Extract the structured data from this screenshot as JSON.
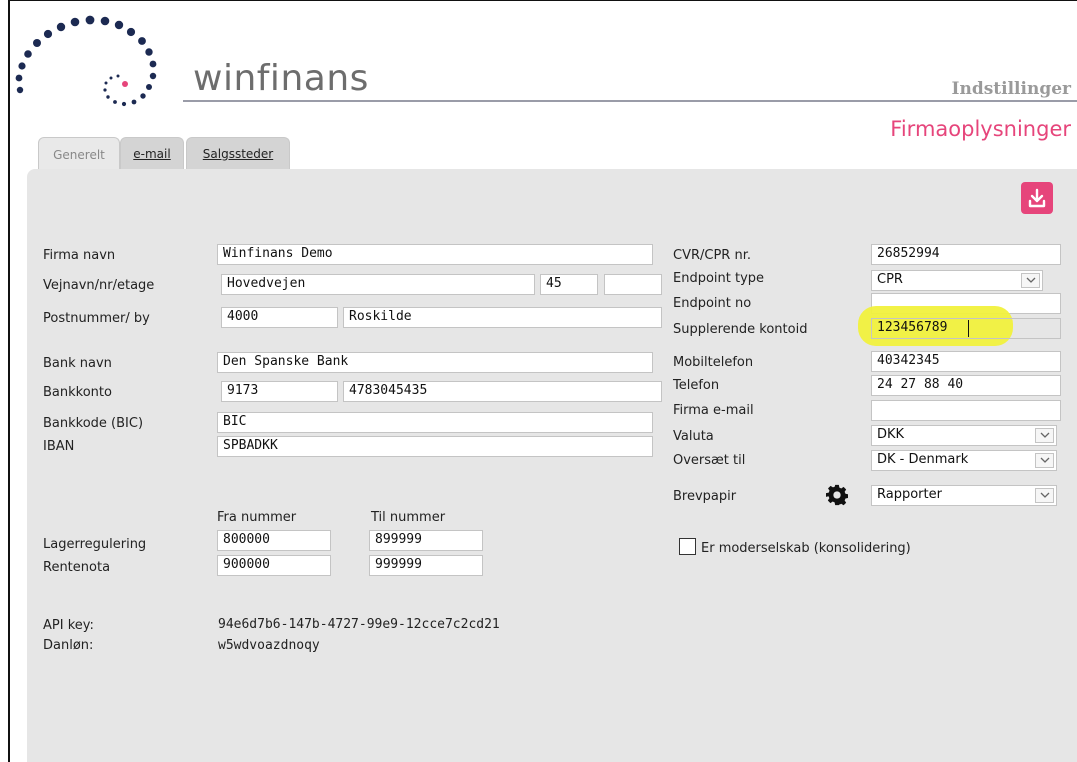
{
  "header": {
    "app_name": "winfinans",
    "settings_label": "Indstillinger",
    "page_title": "Firmaoplysninger"
  },
  "tabs": [
    {
      "label": "Generelt",
      "active": true
    },
    {
      "label": "e-mail",
      "active": false
    },
    {
      "label": "Salgssteder",
      "active": false
    }
  ],
  "form": {
    "firma_navn": {
      "label": "Firma navn",
      "value": "Winfinans Demo"
    },
    "vejnavn": {
      "label": "Vejnavn/nr/etage",
      "street": "Hovedvejen",
      "number": "45",
      "floor": ""
    },
    "postnummer": {
      "label": "Postnummer/ by",
      "zip": "4000",
      "city": "Roskilde"
    },
    "bank_navn": {
      "label": "Bank navn",
      "value": "Den Spanske Bank"
    },
    "bankkonto": {
      "label": "Bankkonto",
      "reg": "9173",
      "account": "4783045435"
    },
    "bankkode": {
      "label": "Bankkode (BIC)",
      "value": "BIC"
    },
    "iban": {
      "label": "IBAN",
      "value": "SPBADKK"
    },
    "numbers": {
      "from_header": "Fra nummer",
      "to_header": "Til nummer",
      "rows": [
        {
          "label": "Lagerregulering",
          "from": "800000",
          "to": "899999"
        },
        {
          "label": "Rentenota",
          "from": "900000",
          "to": "999999"
        }
      ]
    },
    "api_key": {
      "label": "API key:",
      "value": "94e6d7b6-147b-4727-99e9-12cce7c2cd21"
    },
    "danlon": {
      "label": "Danløn:",
      "value": "w5wdvoazdnoqy"
    },
    "cvr": {
      "label": "CVR/CPR nr.",
      "value": "26852994"
    },
    "endpoint_type": {
      "label": "Endpoint type",
      "value": "CPR"
    },
    "endpoint_no": {
      "label": "Endpoint no",
      "value": ""
    },
    "supplerende": {
      "label": "Supplerende kontoid",
      "value": "123456789"
    },
    "mobil": {
      "label": "Mobiltelefon",
      "value": "40342345"
    },
    "telefon": {
      "label": "Telefon",
      "value": "24 27 88 40"
    },
    "firma_email": {
      "label": "Firma e-mail",
      "value": ""
    },
    "valuta": {
      "label": "Valuta",
      "value": "DKK"
    },
    "oversaet": {
      "label": "Oversæt til",
      "value": "DK - Denmark"
    },
    "brevpapir": {
      "label": "Brevpapir",
      "value": "Rapporter"
    },
    "moderselskab": {
      "label": "Er moderselskab (konsolidering)",
      "checked": false
    }
  },
  "icons": {
    "download": "download-icon",
    "gear": "gear-icon",
    "accent_color": "#e6457b",
    "highlight_color": "#f1f13d"
  }
}
